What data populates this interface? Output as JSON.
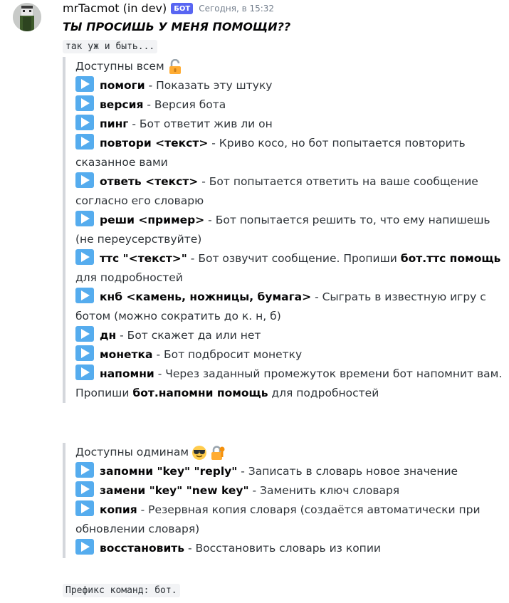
{
  "message": {
    "username": "mrTacmot (in dev)",
    "bot_tag": "БОТ",
    "timestamp": "Сегодня, в 15:32",
    "title": "ТЫ ПРОСИШЬ У МЕНЯ ПОМОЩИ??",
    "intro_code": "так уж и быть...",
    "footer_code": "Префикс команд: бот."
  },
  "icons": {
    "avatar": "minecraft-skin-avatar",
    "play": "arrow-forward-emoji",
    "unlock": "unlocked-padlock-emoji",
    "sunglasses": "sunglasses-face-emoji",
    "locked_key": "locked-with-key-emoji",
    "play_color": "#55acee",
    "bot_tag_color": "#5865f2"
  },
  "sections": [
    {
      "title": "Доступны всем",
      "commands": [
        {
          "name": "помоги",
          "desc": " - Показать эту штуку"
        },
        {
          "name": "версия",
          "desc": " - Версия бота"
        },
        {
          "name": "пинг",
          "desc": " - Бот ответит жив ли он"
        },
        {
          "name": "повтори <текст>",
          "desc": " - Криво косо, но бот попытается повторить сказанное вами"
        },
        {
          "name": "ответь <текст>",
          "desc": " - Бот попытается ответить на ваше сообщение согласно его словарю"
        },
        {
          "name": "реши <пример>",
          "desc": " - Бот попытается решить то, что ему напишешь (не переусерствуйте)"
        },
        {
          "name": "ттс \"<текст>\"",
          "desc": " - Бот озвучит сообщение. Пропиши ",
          "bold2": "бот.ттс помощь",
          "desc2": " для подробностей"
        },
        {
          "name": "кнб <камень, ножницы, бумага>",
          "desc": " - Сыграть в известную игру с ботом (можно сократить до к. н, б)"
        },
        {
          "name": "дн",
          "desc": " - Бот скажет да или нет"
        },
        {
          "name": "монетка",
          "desc": " - Бот подбросит монетку"
        },
        {
          "name": "напомни",
          "desc": " - Через заданный промежуток времени бот напомнит вам. Пропиши ",
          "bold2": "бот.напомни помощь",
          "desc2": " для подробностей"
        }
      ]
    },
    {
      "title": "Доступны одминам",
      "commands": [
        {
          "name": "запомни \"key\" \"reply\"",
          "desc": " - Записать в словарь новое значение"
        },
        {
          "name": "замени \"key\" \"new key\"",
          "desc": " - Заменить ключ словаря"
        },
        {
          "name": "копия",
          "desc": " - Резервная копия словаря (создаётся автоматически при обновлении словаря)"
        },
        {
          "name": "восстановить",
          "desc": " - Восстановить словарь из копии"
        }
      ]
    }
  ]
}
